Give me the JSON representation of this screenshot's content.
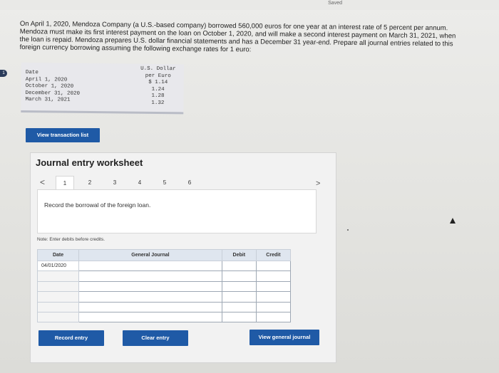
{
  "status": {
    "saved": "Saved"
  },
  "problem": {
    "text": "On April 1, 2020, Mendoza Company (a U.S.-based company) borrowed 560,000 euros for one year at an interest rate of 5 percent per annum. Mendoza must make its first interest payment on the loan on October 1, 2020, and will make a second interest payment on March 31, 2021, when the loan is repaid. Mendoza prepares U.S. dollar financial statements and has a December 31 year-end. Prepare all journal entries related to this foreign currency borrowing assuming the following exchange rates for 1 euro:"
  },
  "rates_table": {
    "header_date": "Date",
    "header_rate_line1": "U.S. Dollar",
    "header_rate_line2": "per Euro",
    "rows": [
      {
        "date": "April 1, 2020",
        "rate": "$ 1.14"
      },
      {
        "date": "October 1, 2020",
        "rate": "1.24"
      },
      {
        "date": "December 31, 2020",
        "rate": "1.28"
      },
      {
        "date": "March 31, 2021",
        "rate": "1.32"
      }
    ]
  },
  "buttons": {
    "view_transaction_list": "View transaction list",
    "record_entry": "Record entry",
    "clear_entry": "Clear entry",
    "view_general_journal": "View general journal"
  },
  "worksheet": {
    "title": "Journal entry worksheet",
    "prev": "<",
    "next": ">",
    "steps": [
      "1",
      "2",
      "3",
      "4",
      "5",
      "6"
    ],
    "active_step": 1,
    "instruction": "Record the borrowal of the foreign loan.",
    "note": "Note: Enter debits before credits."
  },
  "journal": {
    "headers": {
      "date": "Date",
      "general_journal": "General Journal",
      "debit": "Debit",
      "credit": "Credit"
    },
    "rows": [
      {
        "date": "04/01/2020",
        "account": "",
        "debit": "",
        "credit": ""
      },
      {
        "date": "",
        "account": "",
        "debit": "",
        "credit": ""
      },
      {
        "date": "",
        "account": "",
        "debit": "",
        "credit": ""
      },
      {
        "date": "",
        "account": "",
        "debit": "",
        "credit": ""
      },
      {
        "date": "",
        "account": "",
        "debit": "",
        "credit": ""
      },
      {
        "date": "",
        "account": "",
        "debit": "",
        "credit": ""
      }
    ]
  },
  "colors": {
    "button_blue": "#1f5aa6",
    "table_header": "#dfe6ef"
  }
}
